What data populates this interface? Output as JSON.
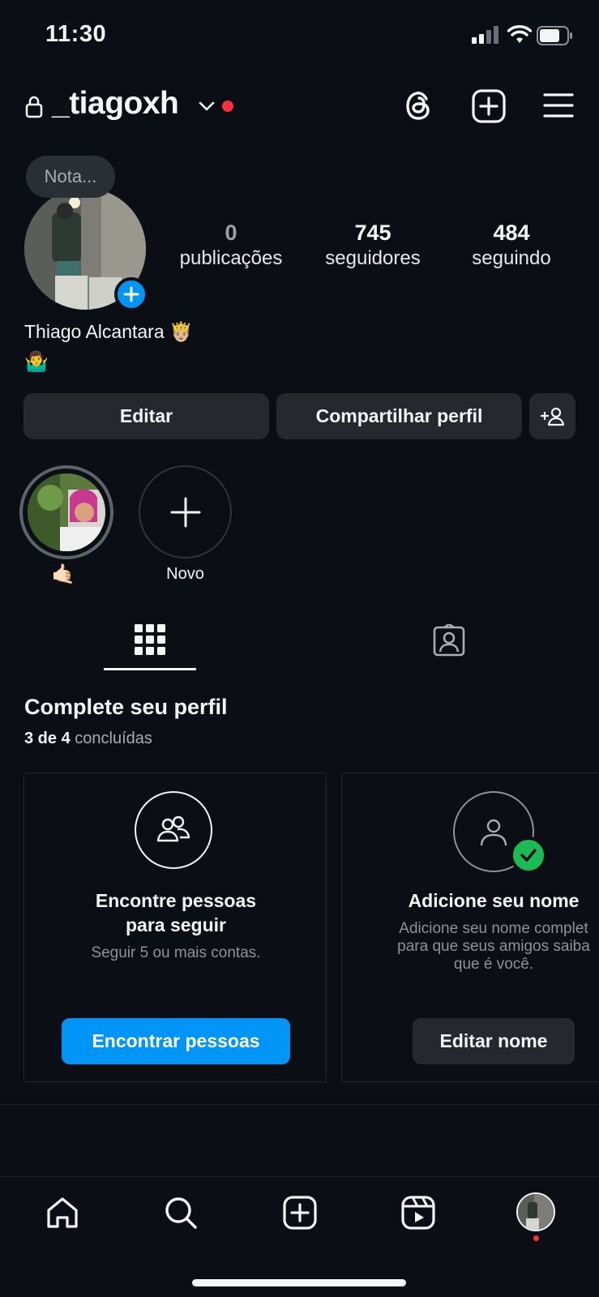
{
  "status_bar": {
    "time": "11:30"
  },
  "header": {
    "username": "_tiagoxh"
  },
  "profile": {
    "note_placeholder": "Nota...",
    "stats": [
      {
        "value": "0",
        "label": "publicações"
      },
      {
        "value": "745",
        "label": "seguidores"
      },
      {
        "value": "484",
        "label": "seguindo"
      }
    ],
    "display_name": "Thiago Alcantara 🤴🏼",
    "bio": "🤷‍♂️"
  },
  "actions": {
    "edit": "Editar",
    "share": "Compartilhar perfil"
  },
  "highlights": [
    {
      "label": "🤙🏻"
    },
    {
      "label": "Novo"
    }
  ],
  "complete_profile": {
    "title": "Complete seu perfil",
    "progress_bold": "3 de 4",
    "progress_rest": "concluídas",
    "cards": [
      {
        "title_line1": "Encontre pessoas",
        "title_line2": "para seguir",
        "desc": "Seguir 5 ou mais contas.",
        "button": "Encontrar pessoas"
      },
      {
        "title_line1": "Adicione seu nome",
        "desc_line1": "Adicione seu nome complet",
        "desc_line2": "para que seus amigos saiba",
        "desc_line3": "que é você.",
        "button": "Editar nome"
      }
    ]
  },
  "colors": {
    "background": "#0b0f15",
    "accent": "#0095f6",
    "notification": "#ff3040",
    "success": "#1db954"
  }
}
